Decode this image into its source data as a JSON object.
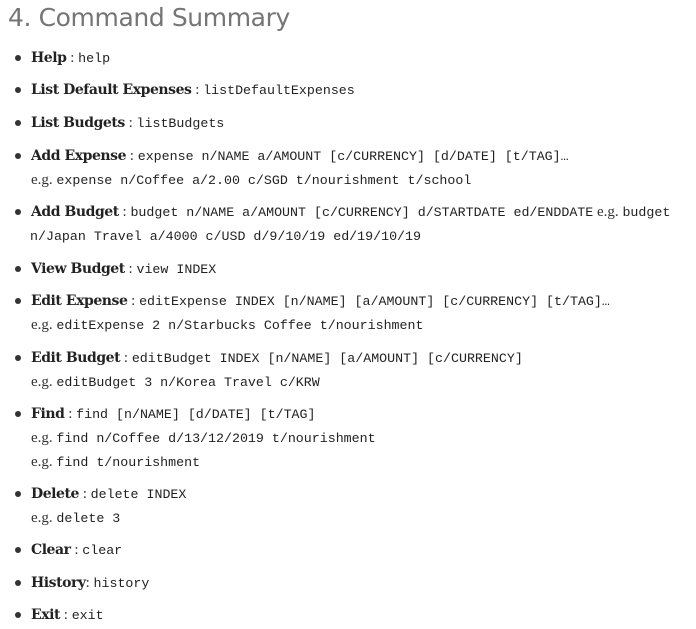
{
  "heading": "4. Command Summary",
  "items": [
    {
      "name": "help",
      "label": "Help",
      "sep": " : ",
      "code": "help"
    },
    {
      "name": "list-default-expenses",
      "label": "List Default Expenses",
      "sep": " : ",
      "code": "listDefaultExpenses"
    },
    {
      "name": "list-budgets",
      "label": "List Budgets",
      "sep": " : ",
      "code": "listBudgets"
    },
    {
      "name": "add-expense",
      "label": "Add Expense",
      "sep": " : ",
      "code": "expense n/NAME a/AMOUNT [c/CURRENCY] [d/DATE] [t/TAG]…",
      "example_prefix": "e.g. ",
      "example_code": "expense n/Coffee a/2.00 c/SGD t/nourishment t/school"
    },
    {
      "name": "add-budget",
      "label": "Add Budget",
      "sep": " : ",
      "code": "budget n/NAME a/AMOUNT [c/CURRENCY] d/STARTDATE ed/ENDDATE",
      "inline_example_prefix": " e.g. ",
      "inline_example_code": "budget",
      "example_code": "n/Japan Travel a/4000 c/USD d/9/10/19 ed/19/10/19"
    },
    {
      "name": "view-budget",
      "label": "View Budget",
      "sep": " : ",
      "code": "view INDEX"
    },
    {
      "name": "edit-expense",
      "label": "Edit Expense",
      "sep": " : ",
      "code": "editExpense INDEX [n/NAME] [a/AMOUNT] [c/CURRENCY] [t/TAG]…",
      "example_prefix": "e.g. ",
      "example_code": "editExpense 2 n/Starbucks Coffee t/nourishment"
    },
    {
      "name": "edit-budget",
      "label": "Edit Budget",
      "sep": " : ",
      "code": "editBudget INDEX [n/NAME] [a/AMOUNT] [c/CURRENCY]",
      "example_prefix": "e.g. ",
      "example_code": "editBudget 3 n/Korea Travel c/KRW"
    },
    {
      "name": "find",
      "label": "Find",
      "sep": " : ",
      "code": "find [n/NAME] [d/DATE] [t/TAG]",
      "example_prefix": "e.g. ",
      "example_code": "find n/Coffee d/13/12/2019 t/nourishment",
      "example2_prefix": "e.g. ",
      "example2_code": "find t/nourishment"
    },
    {
      "name": "delete",
      "label": "Delete",
      "sep": " : ",
      "code": "delete INDEX",
      "example_prefix": "e.g. ",
      "example_code": "delete 3"
    },
    {
      "name": "clear",
      "label": "Clear",
      "sep": " : ",
      "code": "clear"
    },
    {
      "name": "history",
      "label": "History",
      "sep": ": ",
      "code": "history"
    },
    {
      "name": "exit",
      "label": "Exit",
      "sep": " : ",
      "code": "exit"
    }
  ]
}
